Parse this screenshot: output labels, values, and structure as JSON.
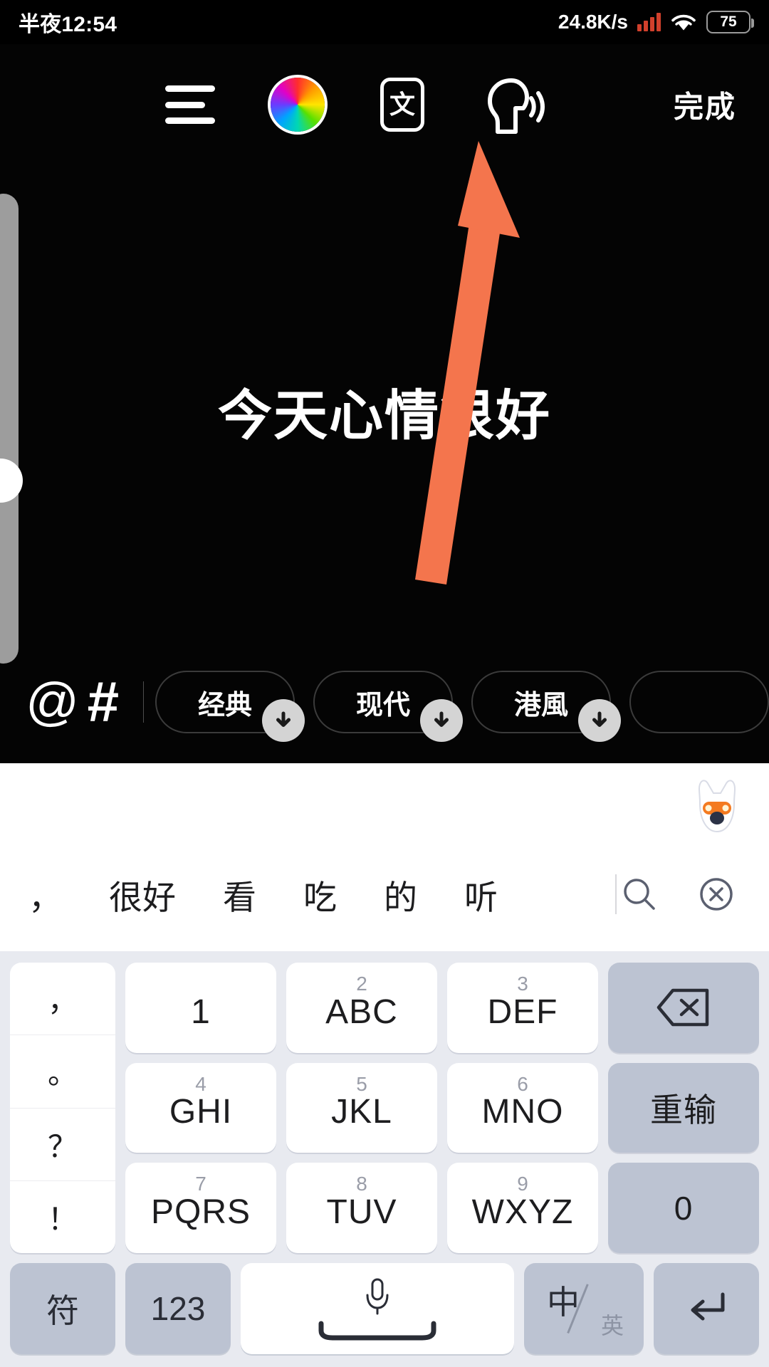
{
  "status_bar": {
    "time": "半夜12:54",
    "network_speed": "24.8K/s",
    "battery_level": "75",
    "signal_color": "#d1402c"
  },
  "toolbar": {
    "align_icon": "align-lines-icon",
    "color_icon": "color-wheel-icon",
    "font_style_label": "文",
    "speak_icon": "text-to-speech-icon",
    "done_label": "完成"
  },
  "canvas": {
    "caption": "今天心情很好",
    "arrow_color": "#f4754d",
    "annotation": "arrow-pointing-to-text-to-speech"
  },
  "font_bar": {
    "at_label": "@",
    "hash_label": "#",
    "chips": [
      {
        "label": "经典",
        "badge": "download"
      },
      {
        "label": "现代",
        "badge": "download"
      },
      {
        "label": "港風",
        "badge": "download"
      },
      {
        "label": "",
        "badge": "download"
      }
    ]
  },
  "keyboard": {
    "logo": "sogou-fox-logo",
    "candidates": [
      "，",
      "很好",
      "看",
      "吃",
      "的",
      "听"
    ],
    "tools": [
      "search-icon",
      "close-circle-icon"
    ],
    "punctuation": [
      "，",
      "。",
      "？",
      "！"
    ],
    "keys": [
      {
        "num": "",
        "label": "1"
      },
      {
        "num": "2",
        "label": "ABC"
      },
      {
        "num": "3",
        "label": "DEF"
      },
      {
        "num": "",
        "label": "backspace-icon",
        "fn": true
      },
      {
        "num": "4",
        "label": "GHI"
      },
      {
        "num": "5",
        "label": "JKL"
      },
      {
        "num": "6",
        "label": "MNO"
      },
      {
        "num": "",
        "label": "重输",
        "fn": true
      },
      {
        "num": "7",
        "label": "PQRS"
      },
      {
        "num": "8",
        "label": "TUV"
      },
      {
        "num": "9",
        "label": "WXYZ"
      },
      {
        "num": "",
        "label": "0",
        "fn": true
      }
    ],
    "bottom_row": {
      "symbol_label": "符",
      "numeric_label": "123",
      "space_label": "microphone-space-key",
      "lang_primary": "中",
      "lang_secondary": "英",
      "return_label": "return-icon"
    }
  }
}
